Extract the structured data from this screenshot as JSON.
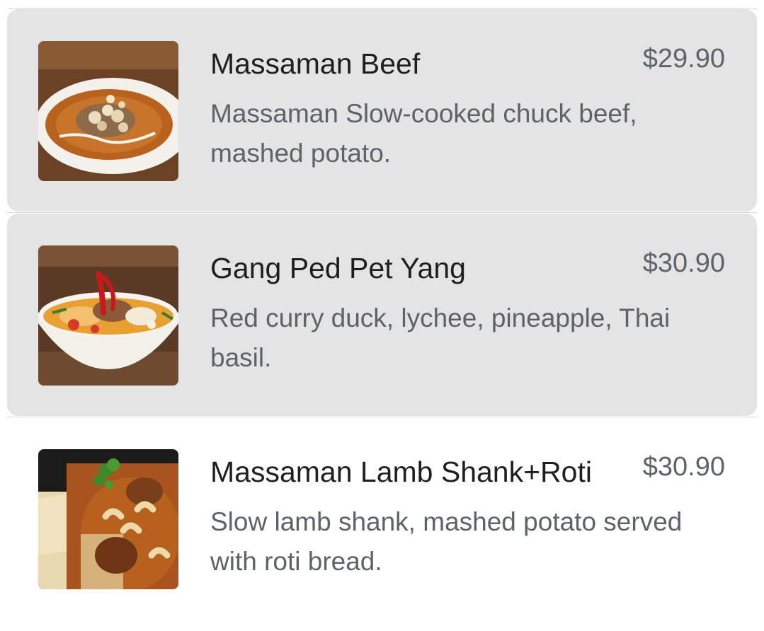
{
  "menu": {
    "items": [
      {
        "name": "Massaman Beef",
        "price": "$29.90",
        "description": "Massaman Slow-cooked chuck beef, mashed potato.",
        "image_icon": "curry-bowl-image",
        "selected": true
      },
      {
        "name": "Gang Ped Pet Yang",
        "price": "$30.90",
        "description": "Red curry duck, lychee, pineapple, Thai basil.",
        "image_icon": "red-curry-bowl-image",
        "selected": true
      },
      {
        "name": "Massaman Lamb Shank+Roti",
        "price": "$30.90",
        "description": "Slow lamb shank, mashed potato served with roti bread.",
        "image_icon": "lamb-shank-image",
        "selected": false
      }
    ]
  },
  "colors": {
    "selected_background": "#e4e4e4",
    "title_text": "#1f1f1f",
    "secondary_text": "#5f6368"
  }
}
